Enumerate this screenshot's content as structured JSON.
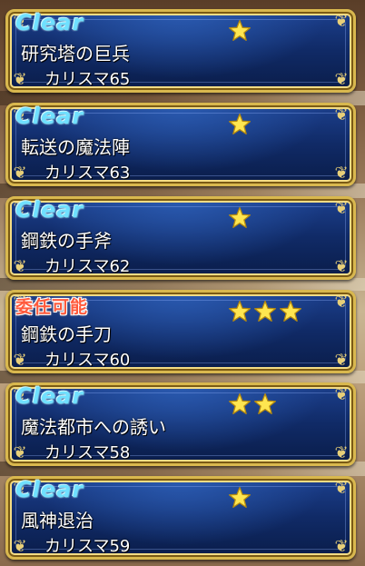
{
  "colors": {
    "clear_text": "#6fe0ff",
    "delegate_text": "#ff5a3c",
    "card_blue": "#102a66",
    "frame_gold": "#d9b84e",
    "star_yellow": "#ffe650"
  },
  "icons": {
    "star": "star-icon",
    "corner": "ornate-corner"
  },
  "missions": [
    {
      "status": "Clear",
      "status_type": "clear",
      "stars": 1,
      "title": "研究塔の巨兵",
      "charisma": "カリスマ65"
    },
    {
      "status": "Clear",
      "status_type": "clear",
      "stars": 1,
      "title": "転送の魔法陣",
      "charisma": "カリスマ63"
    },
    {
      "status": "Clear",
      "status_type": "clear",
      "stars": 1,
      "title": "鋼鉄の手斧",
      "charisma": "カリスマ62"
    },
    {
      "status": "委任可能",
      "status_type": "delegate",
      "stars": 3,
      "title": "鋼鉄の手刀",
      "charisma": "カリスマ60"
    },
    {
      "status": "Clear",
      "status_type": "clear",
      "stars": 2,
      "title": "魔法都市への誘い",
      "charisma": "カリスマ58"
    },
    {
      "status": "Clear",
      "status_type": "clear",
      "stars": 1,
      "title": "風神退治",
      "charisma": "カリスマ59"
    }
  ]
}
